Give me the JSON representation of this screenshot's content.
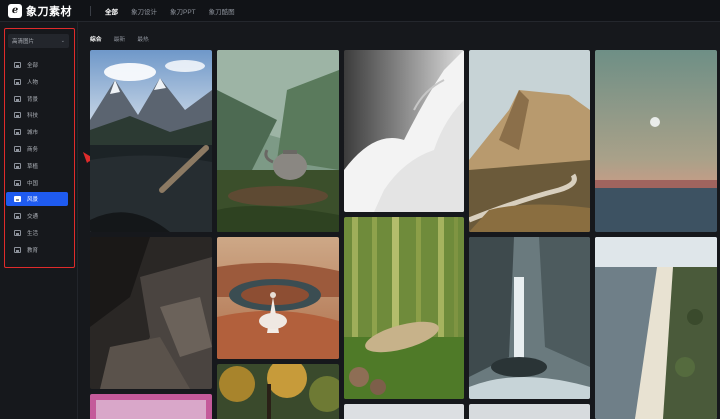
{
  "app": {
    "logo_mark": "ℯ",
    "logo_text": "象刀素材"
  },
  "topnav": [
    "全部",
    "象刀设计",
    "象刀PPT",
    "象刀酷图"
  ],
  "category_select": {
    "value": "高清图片"
  },
  "categories": [
    "全部",
    "人物",
    "背景",
    "科技",
    "城市",
    "商务",
    "草植",
    "中国",
    "风景",
    "交通",
    "生活",
    "教育"
  ],
  "active_category": "风景",
  "subtabs": [
    "综合",
    "最新",
    "最热"
  ],
  "colors": {
    "accent": "#1f5bf0",
    "annotation": "#e02b2b",
    "background": "#16181c"
  },
  "gallery": [
    {
      "id": "mountain-lake",
      "subject": "mountain lake with driftwood"
    },
    {
      "id": "teapot-moss",
      "subject": "teapot on moss in valley"
    },
    {
      "id": "snow-rock",
      "subject": "snow covered rock"
    },
    {
      "id": "cliff-road",
      "subject": "sandstone cliff and winding road"
    },
    {
      "id": "moon-sea",
      "subject": "moon over calm sea at dusk"
    },
    {
      "id": "dark-rocks",
      "subject": "dark rocky cliffs"
    },
    {
      "id": "horseshoe-bend",
      "subject": "person at canyon bend"
    },
    {
      "id": "bamboo-forest",
      "subject": "bamboo forest with log"
    },
    {
      "id": "waterfall",
      "subject": "waterfall in canyon"
    },
    {
      "id": "coastline",
      "subject": "aerial coastline"
    },
    {
      "id": "pink-sky",
      "subject": "pink sky"
    },
    {
      "id": "autumn-trees",
      "subject": "autumn trees"
    },
    {
      "id": "pale-sky-1",
      "subject": "pale sky"
    },
    {
      "id": "pale-sky-2",
      "subject": "pale sky"
    }
  ]
}
